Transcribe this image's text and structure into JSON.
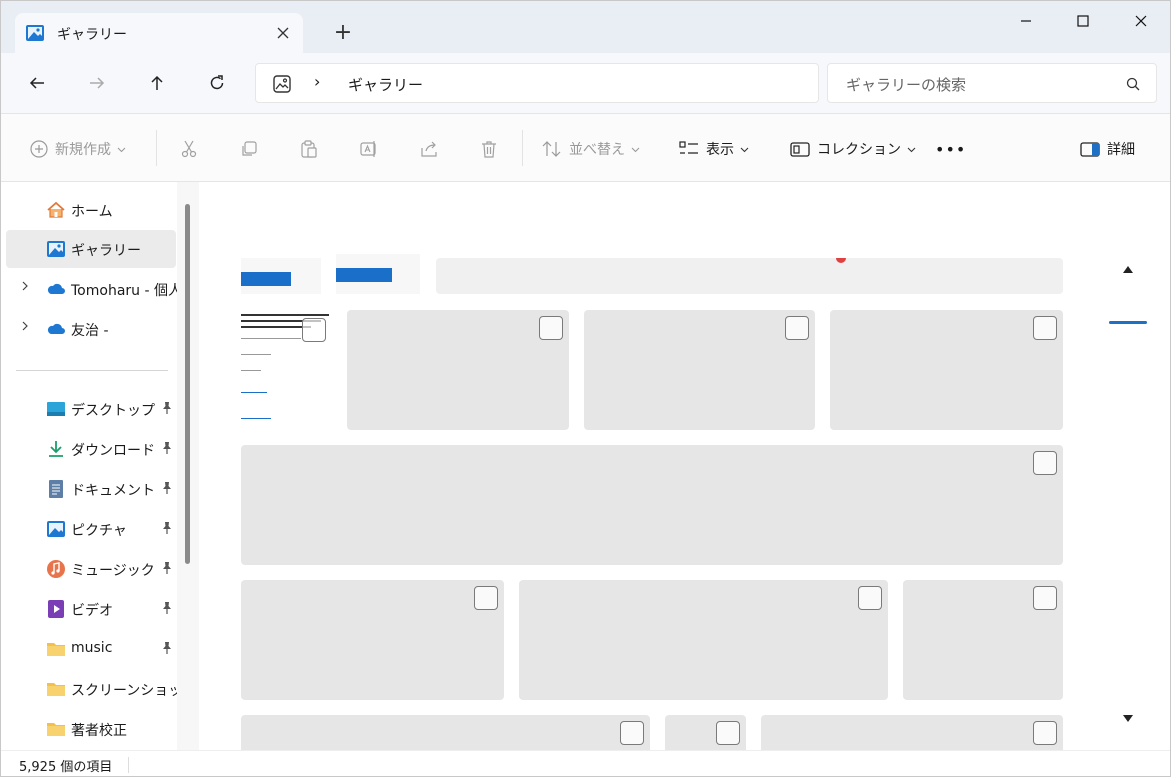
{
  "tab": {
    "title": "ギャラリー",
    "new_tab": "+"
  },
  "window_controls": {
    "minimize": "—",
    "maximize": "☐",
    "close": "✕"
  },
  "address": {
    "crumb": "ギャラリー",
    "separator": "›"
  },
  "search": {
    "placeholder": "ギャラリーの検索"
  },
  "command_bar": {
    "new": "新規作成",
    "sort": "並べ替え",
    "view": "表示",
    "collection": "コレクション",
    "more": "•••",
    "details": "詳細"
  },
  "sidebar": {
    "items": [
      {
        "label": "ホーム",
        "icon": "home-icon"
      },
      {
        "label": "ギャラリー",
        "icon": "gallery-icon",
        "selected": true
      },
      {
        "label": "Tomoharu - 個人",
        "icon": "onedrive-icon"
      },
      {
        "label": "友治 -",
        "icon": "onedrive-icon"
      },
      {
        "label": "デスクトップ",
        "icon": "desktop-icon"
      },
      {
        "label": "ダウンロード",
        "icon": "download-icon"
      },
      {
        "label": "ドキュメント",
        "icon": "document-icon"
      },
      {
        "label": "ピクチャ",
        "icon": "pictures-icon"
      },
      {
        "label": "ミュージック",
        "icon": "music-icon"
      },
      {
        "label": "ビデオ",
        "icon": "video-icon"
      },
      {
        "label": "music",
        "icon": "folder-icon"
      },
      {
        "label": "スクリーンショット",
        "icon": "folder-icon"
      },
      {
        "label": "著者校正",
        "icon": "folder-icon"
      }
    ]
  },
  "status": {
    "item_count": "5,925 個の項目"
  },
  "colors": {
    "accent": "#1f6fc4",
    "tile": "#e6e6e6",
    "selected": "#ebebeb"
  }
}
